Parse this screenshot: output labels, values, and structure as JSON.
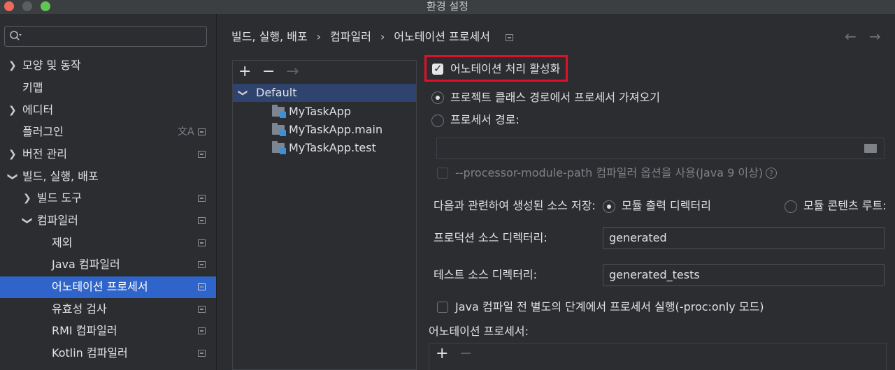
{
  "window": {
    "title": "환경 설정"
  },
  "colors": {
    "accent": "#2f65ca",
    "highlight_border": "#e0102a",
    "background": "#2b2d30"
  },
  "search": {
    "placeholder": "",
    "icon": "search-icon"
  },
  "sidebar": {
    "items": [
      {
        "label": "모양 및 동작",
        "expandable": true,
        "expanded": false
      },
      {
        "label": "키맵"
      },
      {
        "label": "에디터",
        "expandable": true,
        "expanded": false
      },
      {
        "label": "플러그인"
      },
      {
        "label": "버전 관리",
        "expandable": true,
        "expanded": false
      },
      {
        "label": "빌드, 실행, 배포",
        "expandable": true,
        "expanded": true
      },
      {
        "label": "빌드 도구",
        "expandable": true,
        "expanded": false
      },
      {
        "label": "컴파일러",
        "expandable": true,
        "expanded": true
      },
      {
        "label": "제외"
      },
      {
        "label": "Java 컴파일러"
      },
      {
        "label": "어노테이션 프로세서",
        "selected": true
      },
      {
        "label": "유효성 검사"
      },
      {
        "label": "RMI 컴파일러"
      },
      {
        "label": "Kotlin 컴파일러"
      }
    ]
  },
  "breadcrumb": {
    "parts": [
      "빌드, 실행, 배포",
      "컴파일러",
      "어노테이션 프로세서"
    ],
    "separator": "›"
  },
  "nav": {
    "back": "←",
    "forward": "→"
  },
  "profiles": {
    "toolbar": {
      "add": "+",
      "remove": "−",
      "move": "→"
    },
    "tree": [
      {
        "label": "Default",
        "expanded": true,
        "selected": true
      },
      {
        "label": "MyTaskApp"
      },
      {
        "label": "MyTaskApp.main"
      },
      {
        "label": "MyTaskApp.test"
      }
    ]
  },
  "settings": {
    "enable_processing": {
      "label": "어노테이션 처리 활성화",
      "checked": true
    },
    "obtain_from_classpath": {
      "label": "프로젝트 클래스 경로에서 프로세서 가져오기",
      "checked": true
    },
    "processor_path": {
      "label": "프로세서 경로:",
      "checked": false,
      "value": ""
    },
    "module_path": {
      "label": "--processor-module-path 컴파일러 옵션을 사용(Java 9 이상)",
      "checked": false,
      "help": "?"
    },
    "store_generated": {
      "label": "다음과 관련하여 생성된 소스 저장:",
      "option_output": "모듈 출력 디렉터리",
      "option_content_root": "모듈 콘텐츠 루트:"
    },
    "production_dir": {
      "label": "프로덕션 소스 디렉터리:",
      "value": "generated"
    },
    "test_dir": {
      "label": "테스트 소스 디렉터리:",
      "value": "generated_tests"
    },
    "proc_only": {
      "label": "Java 컴파일 전 별도의 단계에서 프로세서 실행(-proc:only 모드)",
      "checked": false
    },
    "processors": {
      "label": "어노테이션 프로세서:",
      "add": "+",
      "remove": "−"
    }
  }
}
